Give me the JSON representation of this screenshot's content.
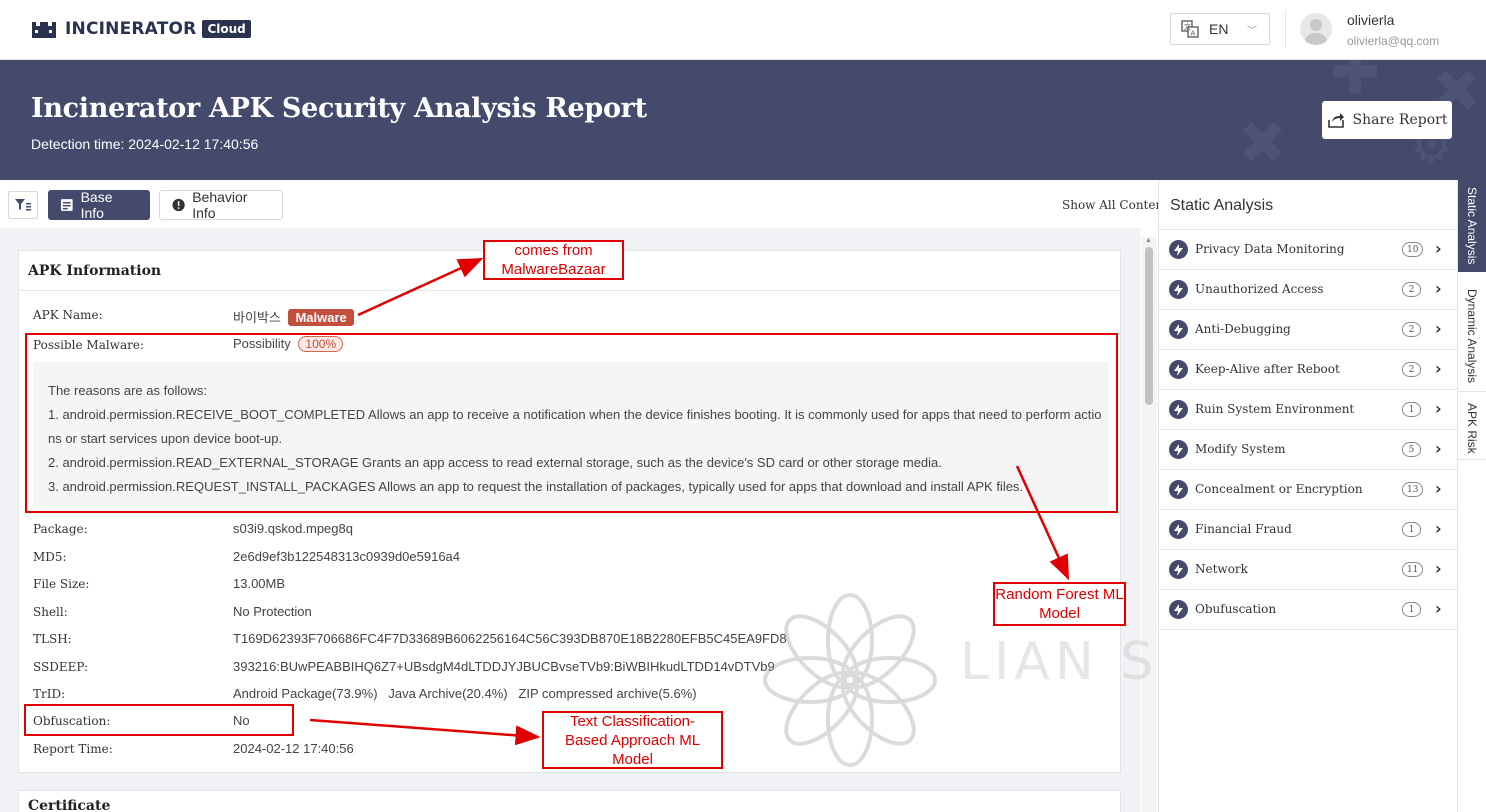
{
  "topbar": {
    "logo_text": "INCINERATOR",
    "logo_badge": "Cloud",
    "language": "EN",
    "user_name": "olivierla",
    "user_email": "olivierla@qq.com"
  },
  "banner": {
    "title": "Incinerator APK Security Analysis Report",
    "detection_time": "Detection time: 2024-02-12 17:40:56",
    "share_label": "Share Report"
  },
  "toolbar": {
    "base_info": "Base Info",
    "behavior_info": "Behavior Info",
    "show_all": "Show All Content"
  },
  "apk_info": {
    "title": "APK Information",
    "apk_name_label": "APK Name:",
    "apk_name_value": "바이박스",
    "apk_name_badge": "Malware",
    "possible_malware_label": "Possible Malware:",
    "possible_malware_value": "Possibility",
    "possible_malware_pct": "100%",
    "reasons": [
      "The reasons are as follows:",
      "1. android.permission.RECEIVE_BOOT_COMPLETED Allows an app to receive a notification when the device finishes booting. It is commonly used for apps that need to perform actio",
      "ns or start services upon device boot-up.",
      "2. android.permission.READ_EXTERNAL_STORAGE Grants an app access to read external storage, such as the device's SD card or other storage media.",
      "3. android.permission.REQUEST_INSTALL_PACKAGES Allows an app to request the installation of packages, typically used for apps that download and install APK files."
    ],
    "rows": [
      {
        "label": "Package:",
        "value": "s03i9.qskod.mpeg8q"
      },
      {
        "label": "MD5:",
        "value": "2e6d9ef3b122548313c0939d0e5916a4"
      },
      {
        "label": "File Size:",
        "value": "13.00MB"
      },
      {
        "label": "Shell:",
        "value": "No Protection"
      },
      {
        "label": "TLSH:",
        "value": "T169D62393F706686FC4F7D33689B6062256164C56C393DB870E18B2280EFB5C45EA9FD8"
      },
      {
        "label": "SSDEEP:",
        "value": "393216:BUwPEABBIHQ6Z7+UBsdgM4dLTDDJYJBUCBvseTVb9:BiWBIHkudLTDD14vDTVb9"
      },
      {
        "label": "TrID:",
        "value": "Android Package(73.9%)   Java Archive(20.4%)   ZIP compressed archive(5.6%)"
      },
      {
        "label": "Obfuscation:",
        "value": "No"
      },
      {
        "label": "Report Time:",
        "value": "2024-02-12 17:40:56"
      }
    ]
  },
  "certificate": {
    "title": "Certificate"
  },
  "watermark": "LIAN SECURITY",
  "static_analysis": {
    "title": "Static Analysis",
    "items": [
      {
        "label": "Privacy Data Monitoring",
        "count": "10"
      },
      {
        "label": "Unauthorized Access",
        "count": "2"
      },
      {
        "label": "Anti-Debugging",
        "count": "2"
      },
      {
        "label": "Keep-Alive after Reboot",
        "count": "2"
      },
      {
        "label": "Ruin System Environment",
        "count": "1"
      },
      {
        "label": "Modify System",
        "count": "5"
      },
      {
        "label": "Concealment or Encryption",
        "count": "13"
      },
      {
        "label": "Financial Fraud",
        "count": "1"
      },
      {
        "label": "Network",
        "count": "11"
      },
      {
        "label": "Obufuscation",
        "count": "1"
      }
    ]
  },
  "side_tabs": [
    "Static Analysis",
    "Dynamic Analysis",
    "APK Risk"
  ],
  "annotations": {
    "malwarebazaar": "comes from MalwareBazaar",
    "random_forest": "Random Forest ML Model",
    "text_classification": "Text Classification-Based Approach ML Model"
  },
  "colors": {
    "brand_navy": "#434a6b",
    "malware_red": "#c24f3c",
    "annotation_red": "#e00000"
  }
}
